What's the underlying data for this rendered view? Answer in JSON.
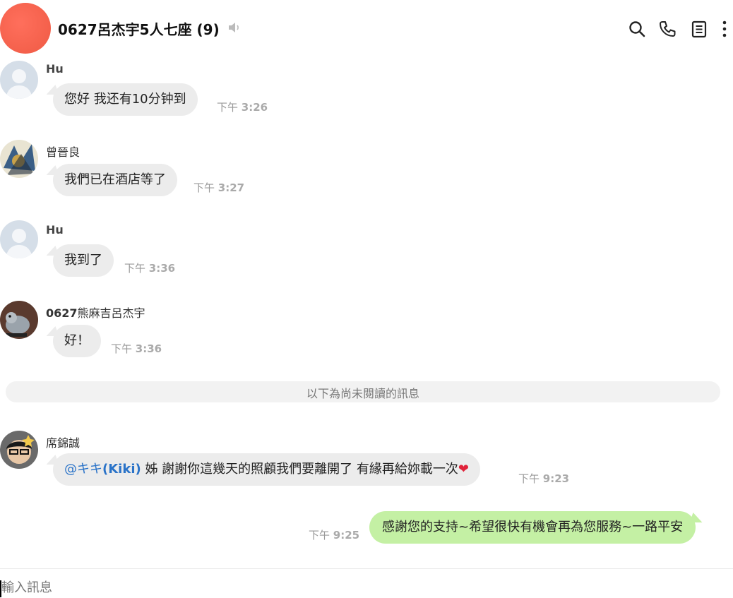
{
  "header": {
    "title": "0627呂杰宇5人七座 (9)",
    "mute_icon": "speaker-icon",
    "icons": [
      "search-icon",
      "phone-icon",
      "notes-icon",
      "more-icon"
    ]
  },
  "messages": [
    {
      "sender": "Hu",
      "text": "您好 我还有10分钟到",
      "time_prefix": "下午",
      "time": "3:26"
    },
    {
      "sender": "曾晉良",
      "text": "我們已在酒店等了",
      "time_prefix": "下午",
      "time": "3:27"
    },
    {
      "sender": "Hu",
      "text": "我到了",
      "time_prefix": "下午",
      "time": "3:36"
    },
    {
      "sender_num": "0627",
      "sender_rest": "熊麻吉呂杰宇",
      "text": "好！",
      "time_prefix": "下午",
      "time": "3:36"
    },
    {
      "sender": "席錦誠",
      "mention_prefix": "@キキ",
      "mention_name": "(Kiki)",
      "text": " 姊 謝謝你這幾天的照顧我們要離開了 有緣再給妳載一次",
      "emoji": "heart",
      "time_prefix": "下午",
      "time": "9:23"
    },
    {
      "sender": "me",
      "text": "感謝您的支持~希望很快有機會再為您服務~一路平安",
      "time_prefix": "下午",
      "time": "9:25"
    }
  ],
  "unread_divider": "以下為尚未閱讀的訊息",
  "composer": {
    "placeholder": "輸入訊息"
  },
  "colors": {
    "outgoing_bubble": "#c4f0a4",
    "incoming_bubble": "#ececec",
    "mention": "#2a73c8",
    "group_avatar": "#ef5a44"
  }
}
